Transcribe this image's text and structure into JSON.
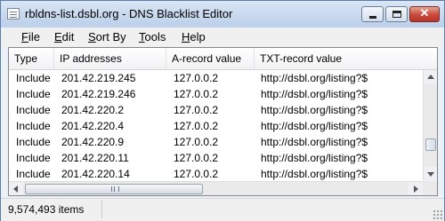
{
  "window": {
    "title": "rbldns-list.dsbl.org - DNS Blacklist Editor"
  },
  "menu": [
    {
      "key": "F",
      "rest": "ile"
    },
    {
      "key": "E",
      "rest": "dit"
    },
    {
      "key": "S",
      "rest": "ort By"
    },
    {
      "key": "T",
      "rest": "ools"
    },
    {
      "key": "H",
      "rest": "elp"
    }
  ],
  "columns": [
    "Type",
    "IP addresses",
    "A-record value",
    "TXT-record value"
  ],
  "rows": [
    [
      "Include",
      "201.42.219.245",
      "127.0.0.2",
      "http://dsbl.org/listing?$"
    ],
    [
      "Include",
      "201.42.219.246",
      "127.0.0.2",
      "http://dsbl.org/listing?$"
    ],
    [
      "Include",
      "201.42.220.2",
      "127.0.0.2",
      "http://dsbl.org/listing?$"
    ],
    [
      "Include",
      "201.42.220.4",
      "127.0.0.2",
      "http://dsbl.org/listing?$"
    ],
    [
      "Include",
      "201.42.220.9",
      "127.0.0.2",
      "http://dsbl.org/listing?$"
    ],
    [
      "Include",
      "201.42.220.11",
      "127.0.0.2",
      "http://dsbl.org/listing?$"
    ],
    [
      "Include",
      "201.42.220.14",
      "127.0.0.2",
      "http://dsbl.org/listing?$"
    ]
  ],
  "status": {
    "count": "9,574,493 items"
  },
  "icons": {
    "app": "document-list-icon",
    "minimize": "minimize-icon",
    "maximize": "maximize-icon",
    "close": "close-icon"
  }
}
